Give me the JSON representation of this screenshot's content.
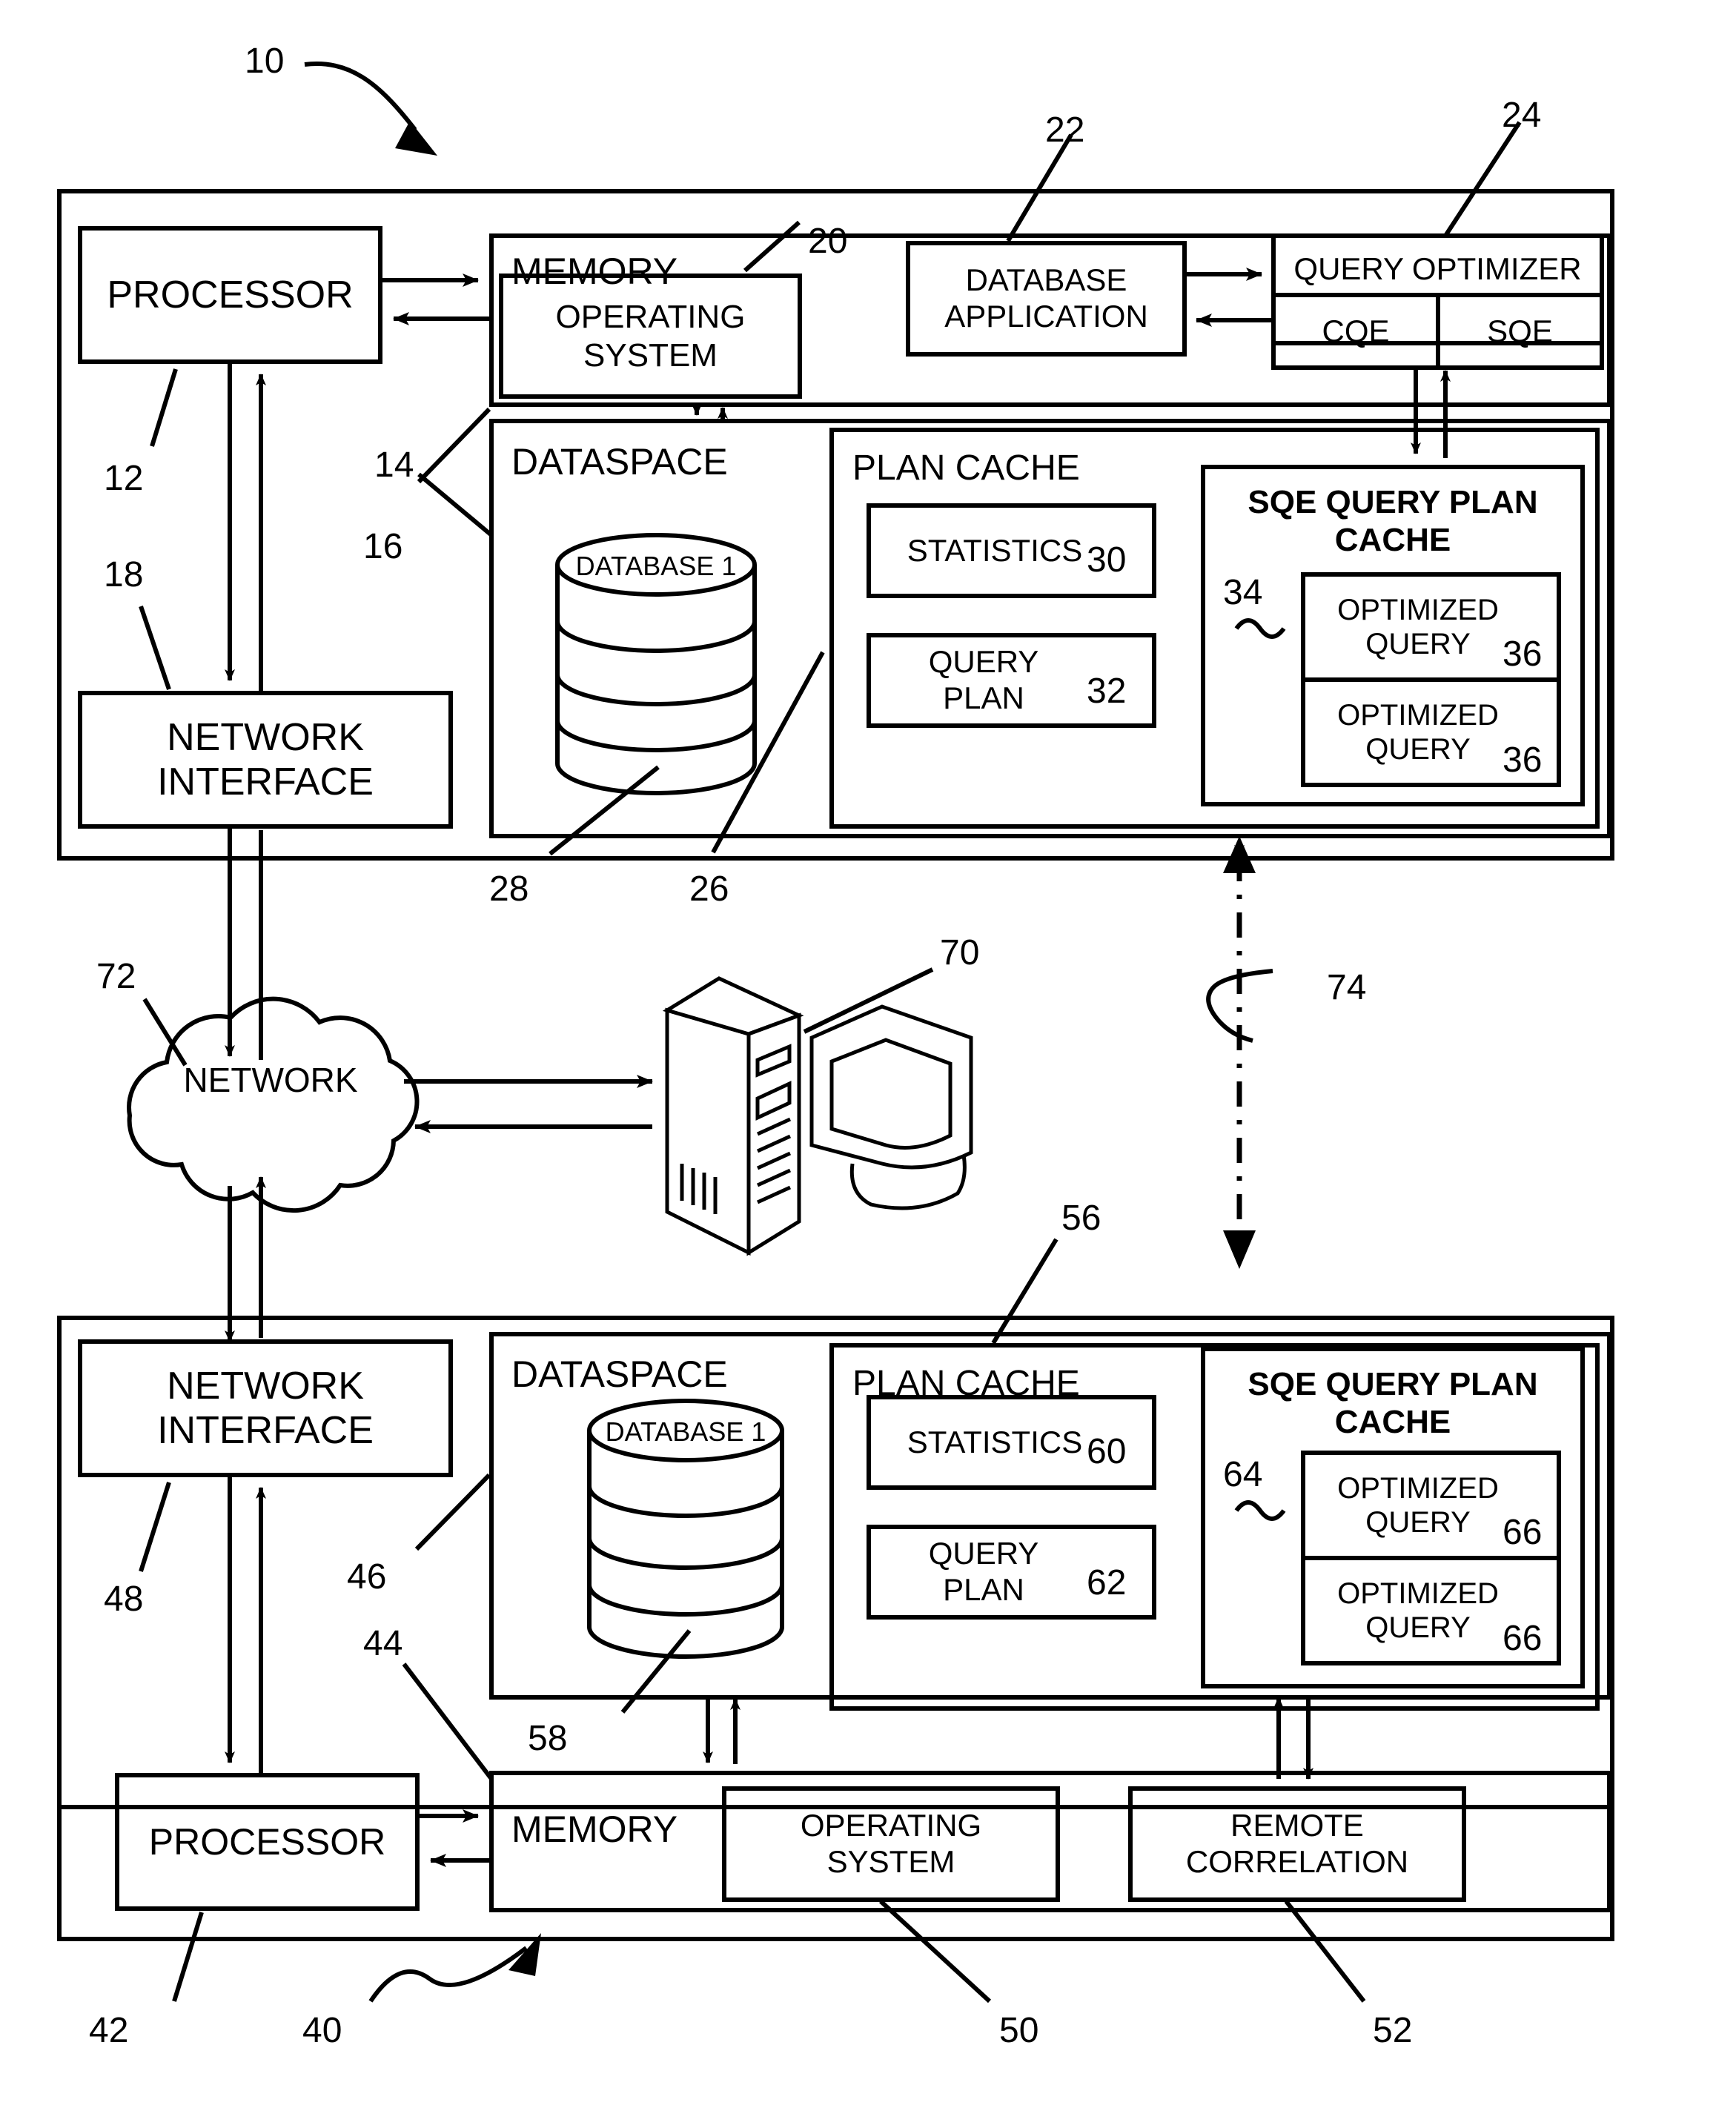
{
  "figure": {
    "type": "patent-block-diagram",
    "description": "Database query optimization system with local and remote nodes"
  },
  "refs": {
    "system": "10",
    "processor_top": "12",
    "memory_top": "14",
    "dataspace_top": "16",
    "network_interface_top": "18",
    "operating_system_top": "20",
    "database_application": "22",
    "query_optimizer": "24",
    "plan_cache_top": "26",
    "database_top": "28",
    "statistics_top": "30",
    "query_plan_top": "32",
    "sqe_query_plan_cache_top": "34",
    "optimized_query_top_1": "36",
    "optimized_query_top_2": "36",
    "remote_system": "40",
    "processor_bottom": "42",
    "memory_bottom": "44",
    "dataspace_bottom": "46",
    "network_interface_bottom": "48",
    "operating_system_bottom": "50",
    "remote_correlation": "52",
    "plan_cache_bottom": "56",
    "database_bottom": "58",
    "statistics_bottom": "60",
    "query_plan_bottom": "62",
    "sqe_query_plan_cache_bottom": "64",
    "optimized_query_bottom_1": "66",
    "optimized_query_bottom_2": "66",
    "workstation": "70",
    "network": "72",
    "link": "74"
  },
  "top_system": {
    "processor": "PROCESSOR",
    "network_interface": "NETWORK\nINTERFACE",
    "network_interface_line1": "NETWORK",
    "network_interface_line2": "INTERFACE",
    "memory": "MEMORY",
    "operating_system_line1": "OPERATING",
    "operating_system_line2": "SYSTEM",
    "database_application_line1": "DATABASE",
    "database_application_line2": "APPLICATION",
    "query_optimizer": "QUERY OPTIMIZER",
    "cqe": "CQE",
    "sqe": "SQE",
    "dataspace": "DATASPACE",
    "database_cylinder": "DATABASE 1",
    "plan_cache": "PLAN CACHE",
    "statistics": "STATISTICS",
    "query_plan_line1": "QUERY",
    "query_plan_line2": "PLAN",
    "sqe_cache_line1": "SQE QUERY PLAN",
    "sqe_cache_line2": "CACHE",
    "optimized_query_line1": "OPTIMIZED",
    "optimized_query_line2": "QUERY"
  },
  "middle": {
    "network_cloud": "NETWORK",
    "workstation_label": "70"
  },
  "bottom_system": {
    "network_interface_line1": "NETWORK",
    "network_interface_line2": "INTERFACE",
    "processor": "PROCESSOR",
    "memory": "MEMORY",
    "operating_system_line1": "OPERATING",
    "operating_system_line2": "SYSTEM",
    "remote_correlation_line1": "REMOTE",
    "remote_correlation_line2": "CORRELATION",
    "dataspace": "DATASPACE",
    "database_cylinder": "DATABASE 1",
    "plan_cache": "PLAN CACHE",
    "statistics": "STATISTICS",
    "query_plan_line1": "QUERY",
    "query_plan_line2": "PLAN",
    "sqe_cache_line1": "SQE QUERY PLAN",
    "sqe_cache_line2": "CACHE",
    "optimized_query_line1": "OPTIMIZED",
    "optimized_query_line2": "QUERY"
  },
  "colors": {
    "stroke": "#000000",
    "background": "#ffffff"
  }
}
